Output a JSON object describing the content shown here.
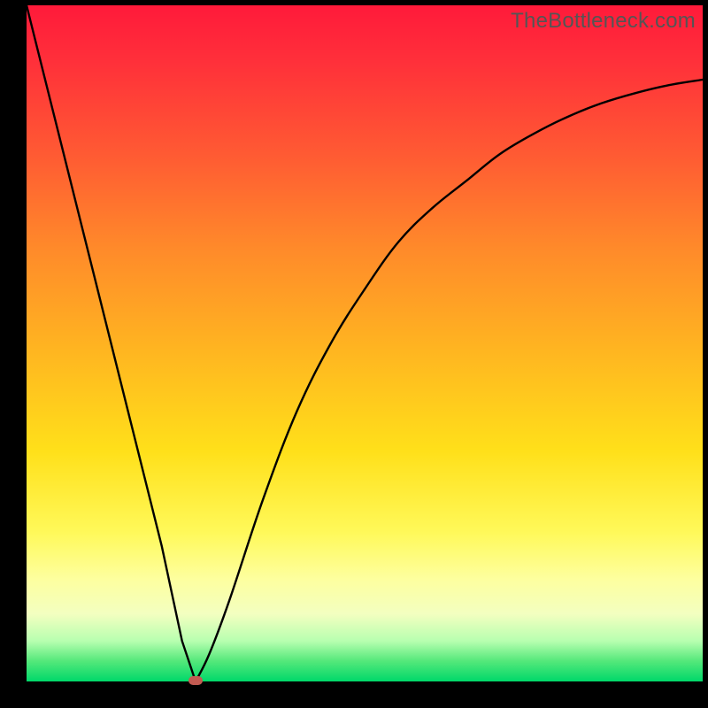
{
  "watermark": "TheBottleneck.com",
  "colors": {
    "frame": "#000000",
    "curve": "#000000",
    "marker": "#c25b52",
    "gradient_top": "#ff1a3a",
    "gradient_bottom": "#00d86a"
  },
  "chart_data": {
    "type": "line",
    "title": "",
    "xlabel": "",
    "ylabel": "",
    "xlim": [
      0,
      100
    ],
    "ylim": [
      0,
      100
    ],
    "grid": false,
    "legend": false,
    "annotations": [],
    "marker": {
      "x": 25,
      "y": 0
    },
    "series": [
      {
        "name": "curve",
        "x": [
          0,
          5,
          10,
          15,
          20,
          23,
          25,
          27,
          30,
          35,
          40,
          45,
          50,
          55,
          60,
          65,
          70,
          75,
          80,
          85,
          90,
          95,
          100
        ],
        "y": [
          100,
          80,
          60,
          40,
          20,
          6,
          0,
          4,
          12,
          27,
          40,
          50,
          58,
          65,
          70,
          74,
          78,
          81,
          83.5,
          85.5,
          87,
          88.2,
          89
        ]
      }
    ],
    "notes": "Values estimated from pixel positions; y=0 is bottom (green), y=100 is top (red). Curve has a sharp V valley near x≈25 then rises with diminishing slope toward the right edge."
  }
}
